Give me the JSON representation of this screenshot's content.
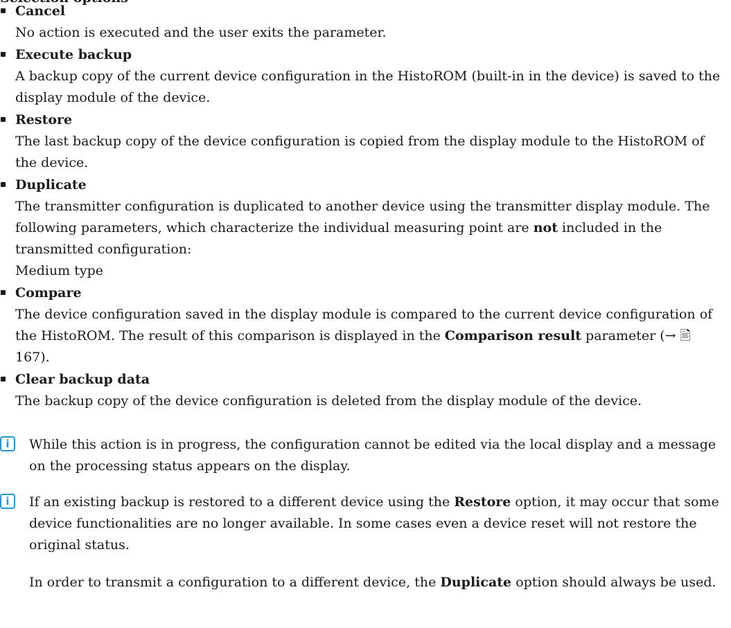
{
  "top_cut_text": "Selection options",
  "options": [
    {
      "title": "Cancel",
      "desc": "No action is executed and the user exits the parameter."
    },
    {
      "title": "Execute backup",
      "desc": "A backup copy of the current device configuration in the HistoROM (built-in in the device) is saved to the display module of the device."
    },
    {
      "title": "Restore",
      "desc": "The last backup copy of the device configuration is copied from the display module to the HistoROM of the device."
    },
    {
      "title": "Duplicate",
      "desc_pre": "The transmitter configuration is duplicated to another device using the transmitter display module. The following parameters, which characterize the individual measuring point are ",
      "desc_bold": "not",
      "desc_post": " included in the transmitted configuration:",
      "desc_line2": "Medium type"
    },
    {
      "title": "Compare",
      "desc_pre": "The device configuration saved in the display module is compared to the current device configuration of the HistoROM. The result of this comparison is displayed in the ",
      "desc_bold": "Comparison result",
      "desc_post": " parameter (→ 🖹 167)."
    },
    {
      "title": "Clear backup data",
      "desc": "The backup copy of the device configuration is deleted from the display module of the device."
    }
  ],
  "notes": [
    {
      "icon": "info-icon",
      "text": "While this action is in progress, the configuration cannot be edited via the local display and a message on the processing status appears on the display."
    },
    {
      "icon": "info-icon",
      "pre": "If an existing backup is restored to a different device using the ",
      "bold": "Restore",
      "post": " option, it may occur that some device functionalities are no longer available. In some cases even a device reset will not restore the original status."
    }
  ],
  "final_para": {
    "pre": "In order to transmit a configuration to a different device, the ",
    "bold": "Duplicate",
    "post": " option should always be used."
  }
}
